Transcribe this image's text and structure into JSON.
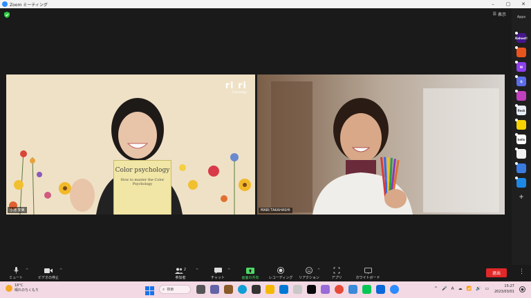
{
  "window": {
    "title": "Zoom ミーティング",
    "buttons": [
      "–",
      "▢",
      "✕"
    ]
  },
  "header": {
    "view_label": "表示"
  },
  "apps_panel": {
    "label": "Apps",
    "apps": [
      {
        "name": "Kahoot!",
        "text": "Kahoot!",
        "color": "#46178f"
      },
      {
        "name": "Orange",
        "text": "",
        "color": "#e8541e"
      },
      {
        "name": "W",
        "text": "W",
        "color": "#8e3ff0"
      },
      {
        "name": "Q",
        "text": "Q",
        "color": "#5b6ee8"
      },
      {
        "name": "Striped",
        "text": "",
        "color": "#c040c0"
      },
      {
        "name": "flesh",
        "text": "flesh",
        "color": "#e8eef8"
      },
      {
        "name": "Smile",
        "text": "",
        "color": "#f5d200"
      },
      {
        "name": "hello",
        "text": "hello",
        "color": "#ffffff"
      },
      {
        "name": "Grid",
        "text": "",
        "color": "#f2f2f2"
      },
      {
        "name": "Sync",
        "text": "",
        "color": "#3a7be0"
      },
      {
        "name": "Z",
        "text": "",
        "color": "#1e88e5"
      }
    ],
    "add": "+"
  },
  "participants": [
    {
      "name": "小池 安美"
    },
    {
      "name": "MARI TAKAHASHI"
    }
  ],
  "left_video": {
    "logo": "ri ri",
    "logo_sub": "Colorology",
    "book_title": "Color psychology",
    "book_subtitle": "How to master the Color Psychology"
  },
  "toolbar": {
    "mute": "ミュート",
    "stop_video": "ビデオの停止",
    "participants": "参加者",
    "participants_count": "2",
    "chat": "チャット",
    "share_screen": "画面の共有",
    "record": "レコーディング",
    "reactions": "リアクション",
    "apps": "アプリ",
    "whiteboard": "ホワイトボード",
    "leave": "退出"
  },
  "taskbar": {
    "temperature": "18°C",
    "weather": "晴れのちくもり",
    "search_placeholder": "検索",
    "time": "15:27",
    "date": "2023/03/01",
    "ime": "A"
  }
}
